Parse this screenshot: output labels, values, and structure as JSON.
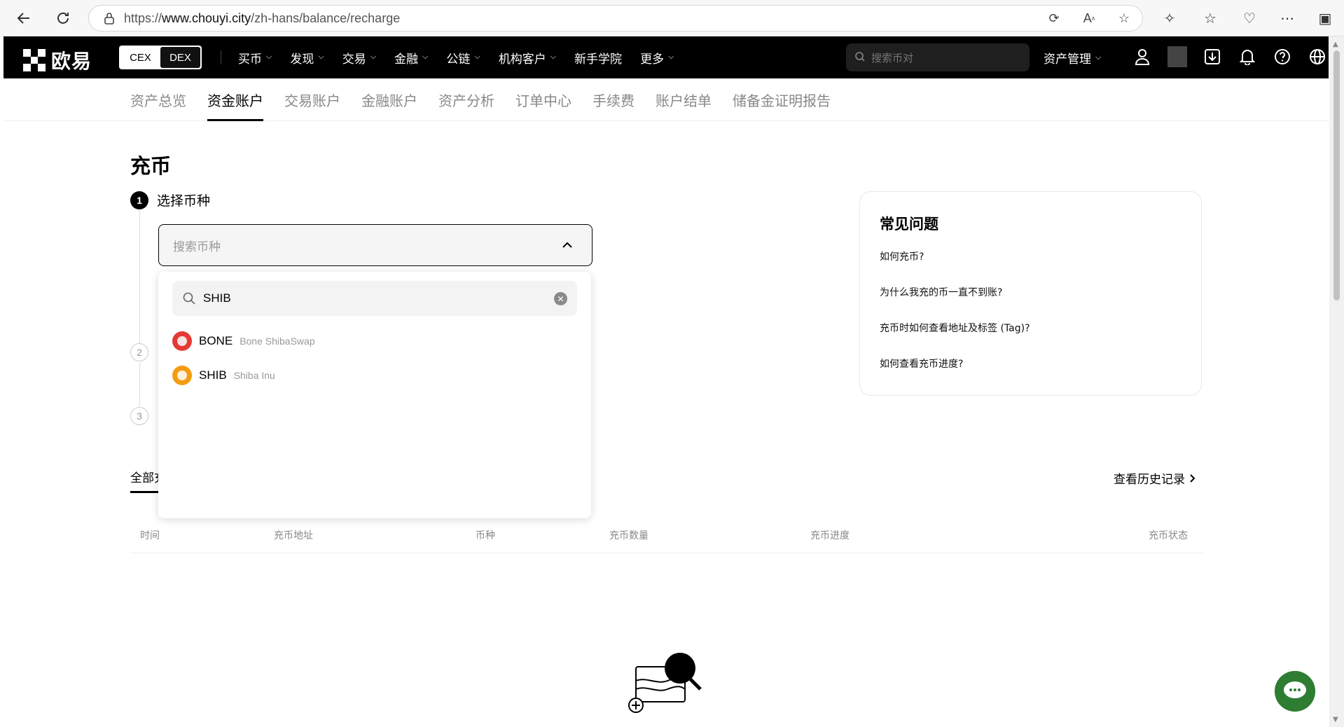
{
  "browser": {
    "url_prefix": "https://",
    "url_host": "www.chouyi.city",
    "url_path": "/zh-hans/balance/recharge"
  },
  "site_nav": {
    "logo_text": "欧易",
    "cex_label": "CEX",
    "dex_label": "DEX",
    "items": [
      {
        "label": "买币",
        "has_dropdown": true
      },
      {
        "label": "发现",
        "has_dropdown": true
      },
      {
        "label": "交易",
        "has_dropdown": true
      },
      {
        "label": "金融",
        "has_dropdown": true
      },
      {
        "label": "公链",
        "has_dropdown": true
      },
      {
        "label": "机构客户",
        "has_dropdown": true
      },
      {
        "label": "新手学院",
        "has_dropdown": false
      },
      {
        "label": "更多",
        "has_dropdown": true
      }
    ],
    "search_placeholder": "搜索币对",
    "asset_management": "资产管理"
  },
  "sub_nav": {
    "items": [
      {
        "label": "资产总览",
        "active": false
      },
      {
        "label": "资金账户",
        "active": true
      },
      {
        "label": "交易账户",
        "active": false
      },
      {
        "label": "金融账户",
        "active": false
      },
      {
        "label": "资产分析",
        "active": false
      },
      {
        "label": "订单中心",
        "active": false
      },
      {
        "label": "手续费",
        "active": false
      },
      {
        "label": "账户结单",
        "active": false
      },
      {
        "label": "储备金证明报告",
        "active": false
      }
    ]
  },
  "page": {
    "title": "充币",
    "step1_num": "1",
    "step1_label": "选择币种",
    "step2_num": "2",
    "step3_num": "3",
    "coin_select_placeholder": "搜索币种"
  },
  "dropdown": {
    "search_value": "SHIB",
    "results": [
      {
        "symbol": "BONE",
        "name": "Bone ShibaSwap",
        "icon": "bone-coin-icon",
        "color": "#e53935"
      },
      {
        "symbol": "SHIB",
        "name": "Shiba Inu",
        "icon": "shiba-coin-icon",
        "color": "#f39c12"
      }
    ]
  },
  "faq": {
    "title": "常见问题",
    "items": [
      "如何充币?",
      "为什么我充的币一直不到账?",
      "充币时如何查看地址及标签 (Tag)?",
      "如何查看充币进度?"
    ]
  },
  "records": {
    "tab_label": "全部充",
    "history_link": "查看历史记录",
    "columns": [
      "时间",
      "充币地址",
      "币种",
      "充币数量",
      "充币进度",
      "充币状态"
    ]
  }
}
